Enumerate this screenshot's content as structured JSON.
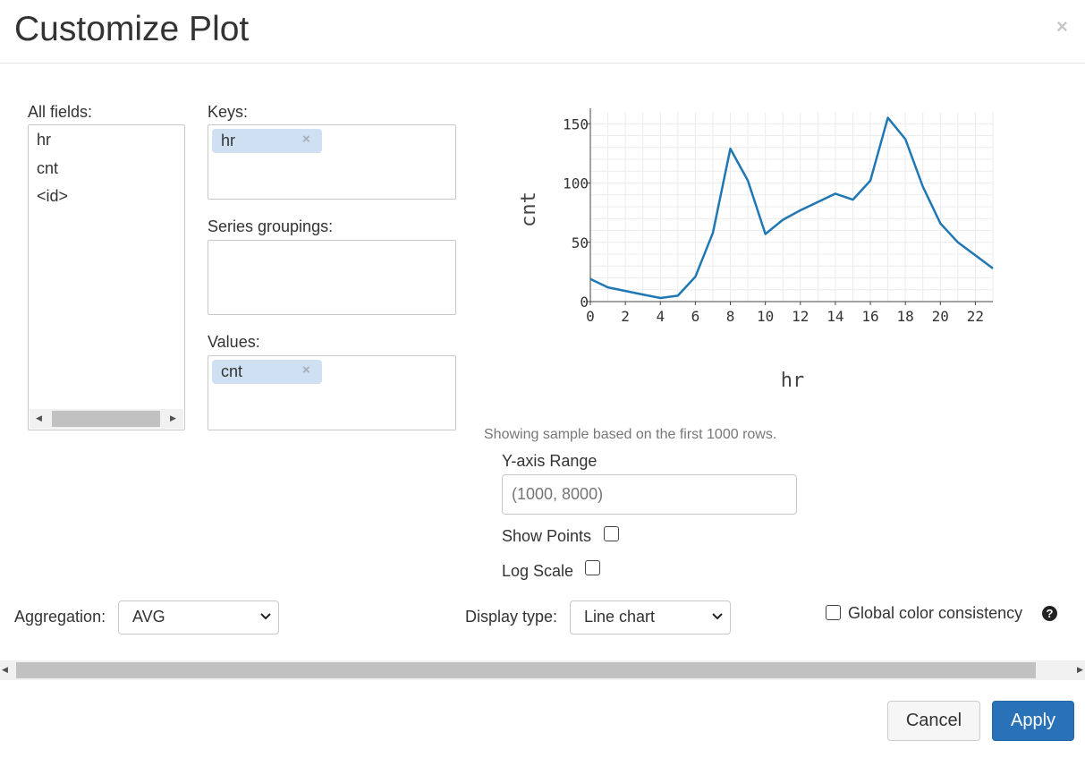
{
  "dialog": {
    "title": "Customize Plot",
    "close_label": "×"
  },
  "fields": {
    "all_fields_label": "All fields:",
    "all_fields": [
      "hr",
      "cnt",
      "<id>"
    ],
    "keys_label": "Keys:",
    "keys": [
      "hr"
    ],
    "series_groupings_label": "Series groupings:",
    "series_groupings": [],
    "values_label": "Values:",
    "values": [
      "cnt"
    ]
  },
  "pill_remove_icon": "×",
  "sample_note": "Showing sample based on the first 1000 rows.",
  "options": {
    "y_axis_range_label": "Y-axis Range",
    "y_axis_range_placeholder": "(1000, 8000)",
    "y_axis_range_value": "",
    "show_points_label": "Show Points",
    "show_points_checked": false,
    "log_scale_label": "Log Scale",
    "log_scale_checked": false
  },
  "aggregation": {
    "label": "Aggregation:",
    "value": "AVG"
  },
  "display_type": {
    "label": "Display type:",
    "value": "Line chart"
  },
  "global_color": {
    "label": "Global color consistency",
    "checked": false,
    "help_icon": "question-circle-icon"
  },
  "buttons": {
    "cancel": "Cancel",
    "apply": "Apply"
  },
  "colors": {
    "line": "#1f77b4",
    "primary_button": "#2a72b8",
    "pill_bg": "#cfe0f2"
  },
  "chart_data": {
    "type": "line",
    "xlabel": "hr",
    "ylabel": "cnt",
    "xlim": [
      0,
      23
    ],
    "ylim": [
      0,
      160
    ],
    "xticks": [
      0,
      2,
      4,
      6,
      8,
      10,
      12,
      14,
      16,
      18,
      20,
      22
    ],
    "yticks": [
      0,
      50,
      100,
      150
    ],
    "grid": true,
    "x": [
      0,
      1,
      2,
      3,
      4,
      5,
      6,
      7,
      8,
      9,
      10,
      11,
      12,
      13,
      14,
      15,
      16,
      17,
      18,
      19,
      20,
      21,
      22,
      23
    ],
    "series": [
      {
        "values": [
          19,
          12,
          9,
          6,
          3,
          5,
          21,
          58,
          129,
          102,
          57,
          69,
          77,
          84,
          91,
          86,
          102,
          155,
          137,
          97,
          66,
          50,
          39,
          28
        ]
      }
    ]
  }
}
